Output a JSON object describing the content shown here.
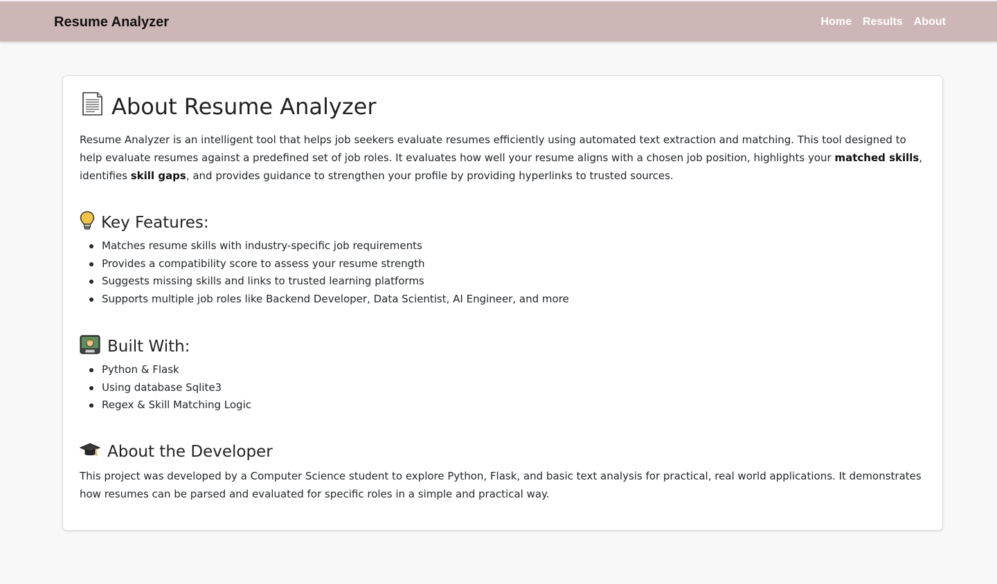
{
  "navbar": {
    "brand": "Resume Analyzer",
    "links": [
      "Home",
      "Results",
      "About"
    ]
  },
  "about": {
    "title": "About Resume Analyzer",
    "title_icon": "page-document-icon",
    "intro": {
      "part1": "Resume Analyzer is an intelligent tool that helps job seekers evaluate resumes efficiently using automated text extraction and matching. This tool designed to help evaluate resumes against a predefined set of job roles. It evaluates how well your resume aligns with a chosen job position, highlights your ",
      "bold1": "matched skills",
      "part2": ", identifies ",
      "bold2": "skill gaps",
      "part3": ", and provides guidance to strengthen your profile by providing hyperlinks to trusted sources."
    }
  },
  "features": {
    "heading": "Key Features:",
    "icon": "light-bulb-icon",
    "items": [
      "Matches resume skills with industry-specific job requirements",
      "Provides a compatibility score to assess your resume strength",
      "Suggests missing skills and links to trusted learning platforms",
      "Supports multiple job roles like Backend Developer, Data Scientist, AI Engineer, and more"
    ]
  },
  "built_with": {
    "heading": "Built With:",
    "icon": "technologist-icon",
    "items": [
      "Python & Flask",
      "Using database Sqlite3",
      "Regex & Skill Matching Logic"
    ]
  },
  "developer": {
    "heading": "About the Developer",
    "icon": "graduation-cap-icon",
    "text": "This project was developed by a Computer Science student to explore Python, Flask, and basic text analysis for practical, real world applications. It demonstrates how resumes can be parsed and evaluated for specific roles in a simple and practical way."
  },
  "colors": {
    "navbar_bg": "#cdb6b6",
    "nav_link": "#ffffff",
    "page_bg": "#f8f8f8",
    "card_bg": "#ffffff"
  }
}
